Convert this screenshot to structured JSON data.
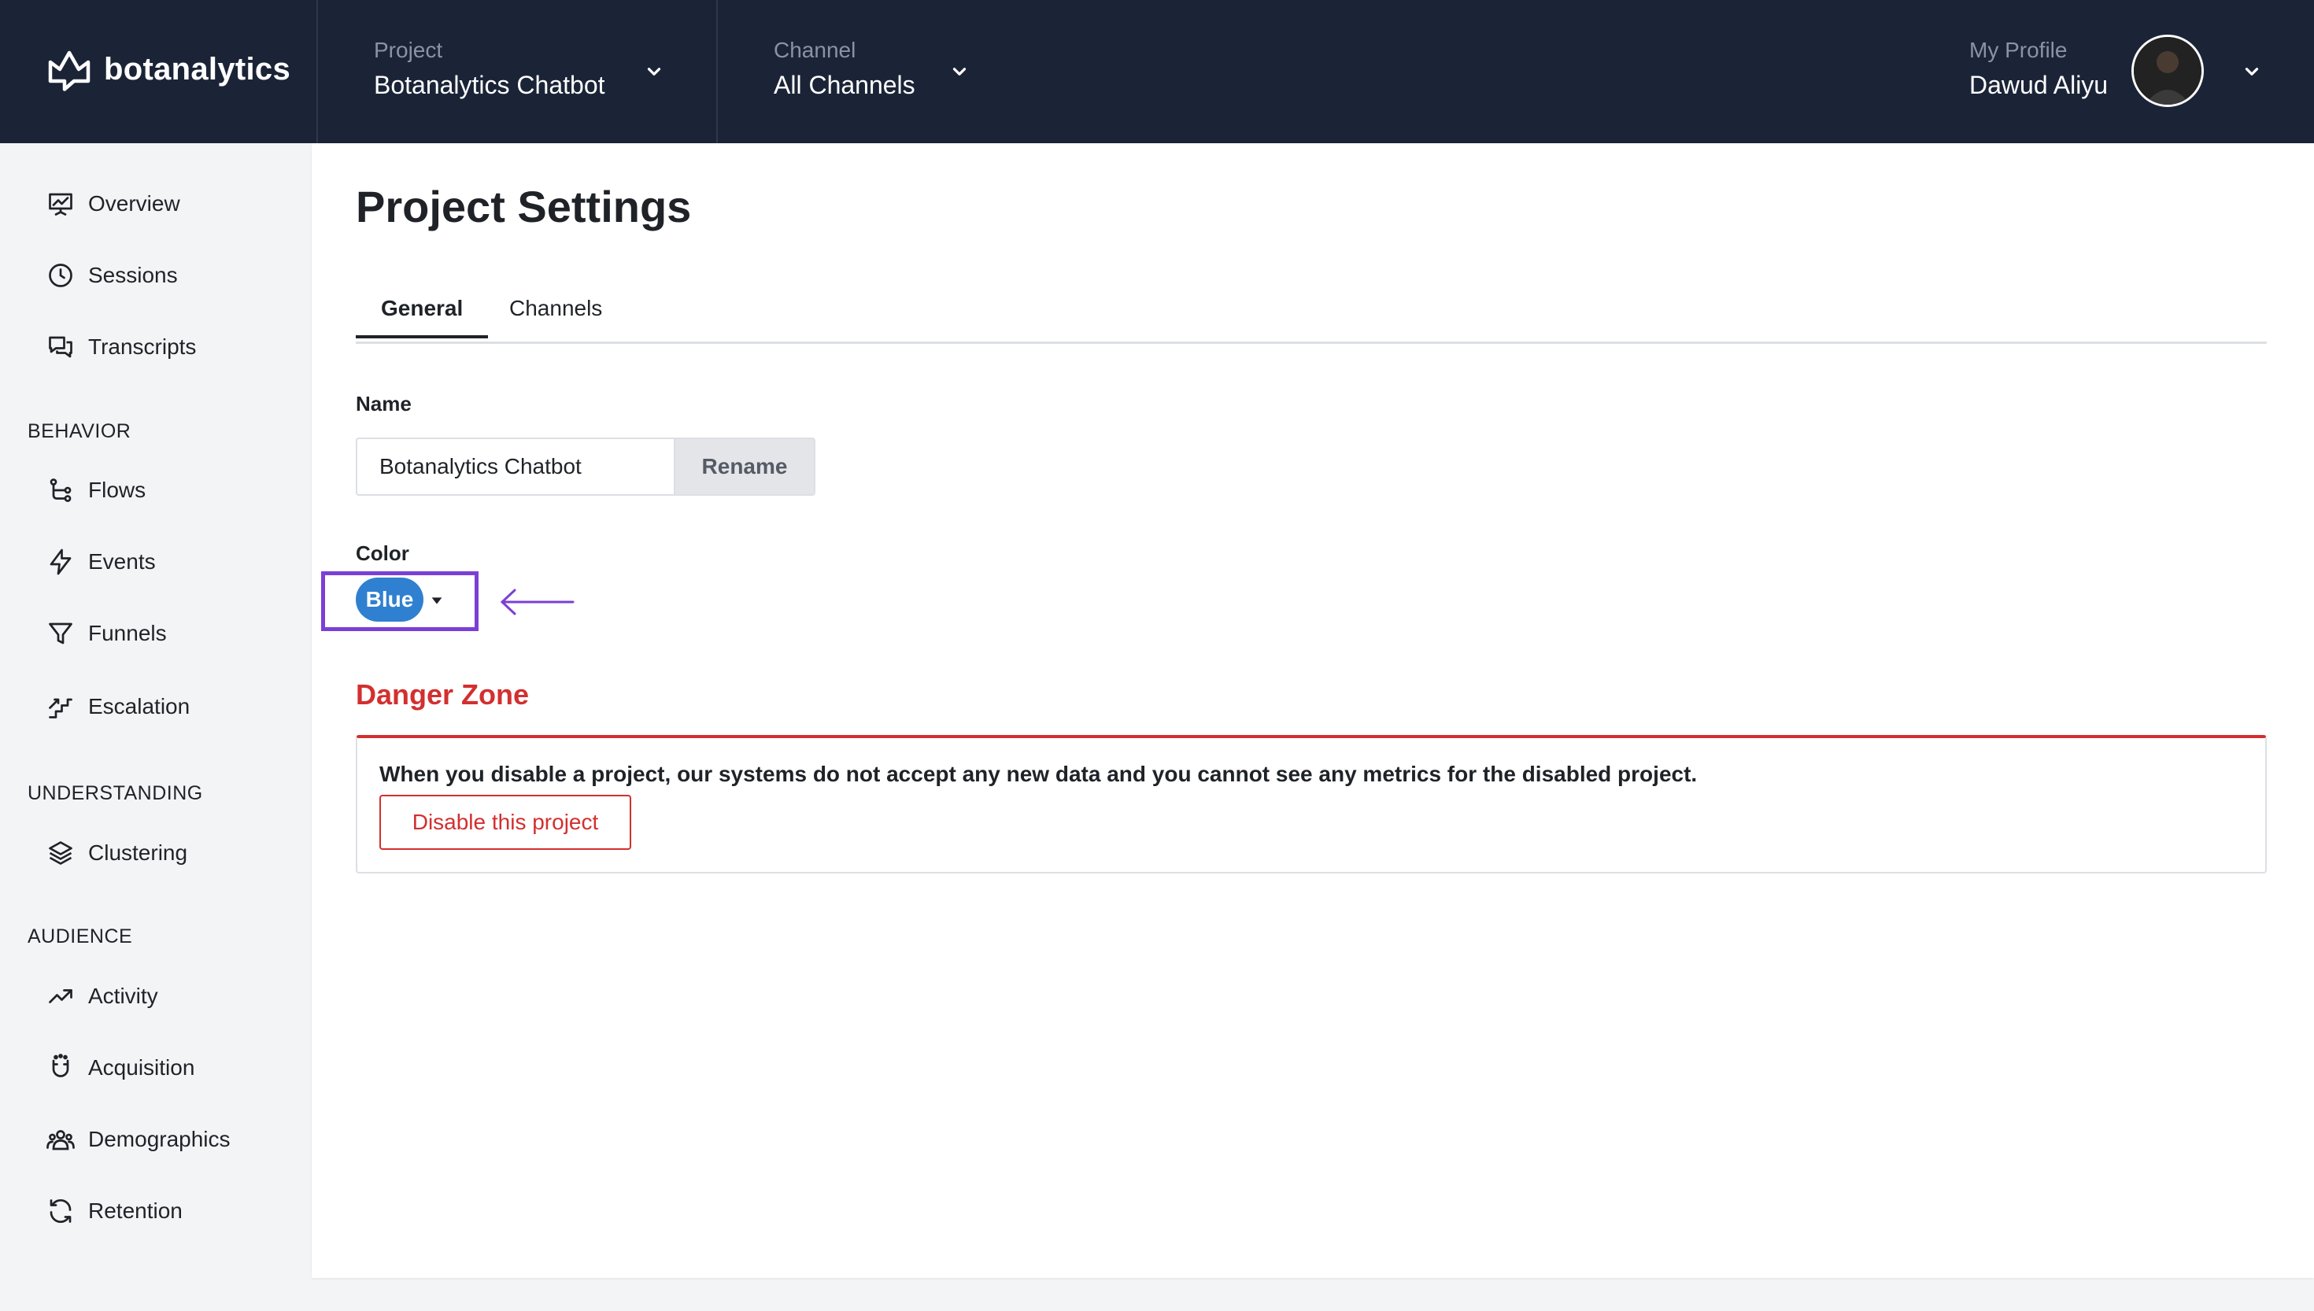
{
  "header": {
    "logo_text": "botanalytics",
    "project_label": "Project",
    "project_value": "Botanalytics Chatbot",
    "channel_label": "Channel",
    "channel_value": "All Channels",
    "profile_label": "My Profile",
    "profile_name": "Dawud Aliyu"
  },
  "sidebar": {
    "items_top": [
      {
        "label": "Overview",
        "icon": "presentation-chart-icon"
      },
      {
        "label": "Sessions",
        "icon": "clock-icon"
      },
      {
        "label": "Transcripts",
        "icon": "chat-bubbles-icon"
      }
    ],
    "behavior_header": "BEHAVIOR",
    "behavior_items": [
      {
        "label": "Flows",
        "icon": "flow-icon"
      },
      {
        "label": "Events",
        "icon": "lightning-icon"
      },
      {
        "label": "Funnels",
        "icon": "funnel-icon"
      },
      {
        "label": "Escalation",
        "icon": "escalation-stairs-icon"
      }
    ],
    "understanding_header": "UNDERSTANDING",
    "understanding_items": [
      {
        "label": "Clustering",
        "icon": "layers-icon"
      }
    ],
    "audience_header": "AUDIENCE",
    "audience_items": [
      {
        "label": "Activity",
        "icon": "trending-up-icon"
      },
      {
        "label": "Acquisition",
        "icon": "magnet-icon"
      },
      {
        "label": "Demographics",
        "icon": "users-icon"
      },
      {
        "label": "Retention",
        "icon": "refresh-icon"
      }
    ]
  },
  "main": {
    "title": "Project Settings",
    "tabs": [
      {
        "label": "General",
        "active": true
      },
      {
        "label": "Channels",
        "active": false
      }
    ],
    "name_label": "Name",
    "name_value": "Botanalytics Chatbot",
    "rename_label": "Rename",
    "color_label": "Color",
    "color_value": "Blue",
    "danger_title": "Danger Zone",
    "danger_text": "When you disable a project, our systems do not accept any new data and you cannot see any metrics for the disabled project.",
    "disable_label": "Disable this project"
  },
  "colors": {
    "header_bg": "#1b2437",
    "accent_blue": "#2f80d0",
    "danger_red": "#d32f2f",
    "highlight_purple": "#7b3fd6"
  }
}
